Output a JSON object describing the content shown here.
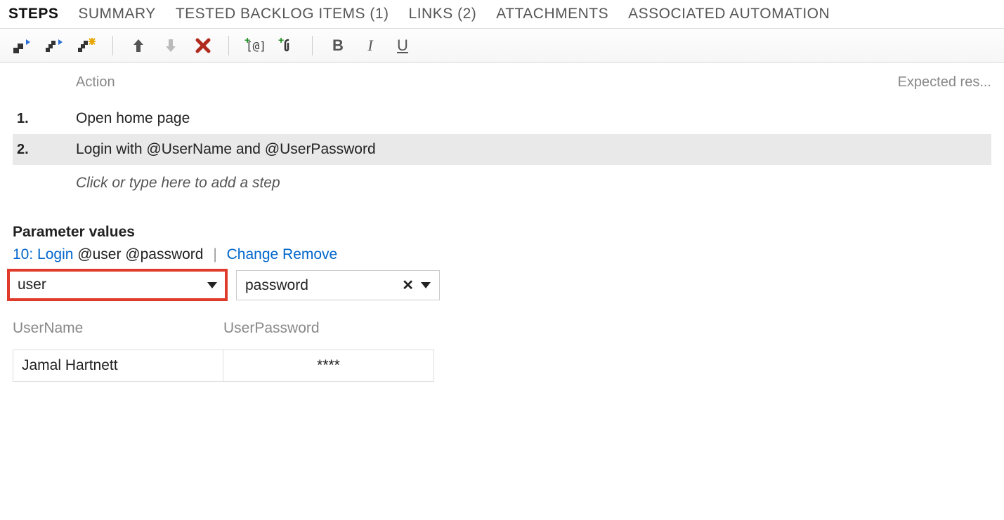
{
  "tabs": [
    {
      "label": "STEPS",
      "active": true
    },
    {
      "label": "SUMMARY",
      "active": false
    },
    {
      "label": "TESTED BACKLOG ITEMS (1)",
      "active": false
    },
    {
      "label": "LINKS (2)",
      "active": false
    },
    {
      "label": "ATTACHMENTS",
      "active": false
    },
    {
      "label": "ASSOCIATED AUTOMATION",
      "active": false
    }
  ],
  "toolbar": {
    "icons": [
      "insert-step-icon",
      "insert-shared-step-icon",
      "new-shared-step-icon",
      "sep",
      "move-up-icon",
      "move-down-icon",
      "delete-icon",
      "sep",
      "add-parameter-icon",
      "add-attachment-icon",
      "sep",
      "bold-icon",
      "italic-icon",
      "underline-icon"
    ],
    "bold_label": "B",
    "italic_label": "I",
    "underline_label": "U"
  },
  "columns": {
    "action": "Action",
    "expected": "Expected res..."
  },
  "steps": [
    {
      "num": "1.",
      "action": "Open home page",
      "selected": false
    },
    {
      "num": "2.",
      "action": "Login with  @UserName and  @UserPassword",
      "selected": true
    }
  ],
  "add_step_placeholder": "Click or type here to add a step",
  "param_section_title": "Parameter values",
  "param_link": {
    "ref": "10: Login",
    "suffix": "@user @password",
    "change": "Change",
    "remove": "Remove"
  },
  "dropdowns": {
    "user": "user",
    "password": "password"
  },
  "param_table": {
    "headers": [
      "UserName",
      "UserPassword"
    ],
    "row": [
      "Jamal Hartnett",
      "****"
    ]
  }
}
